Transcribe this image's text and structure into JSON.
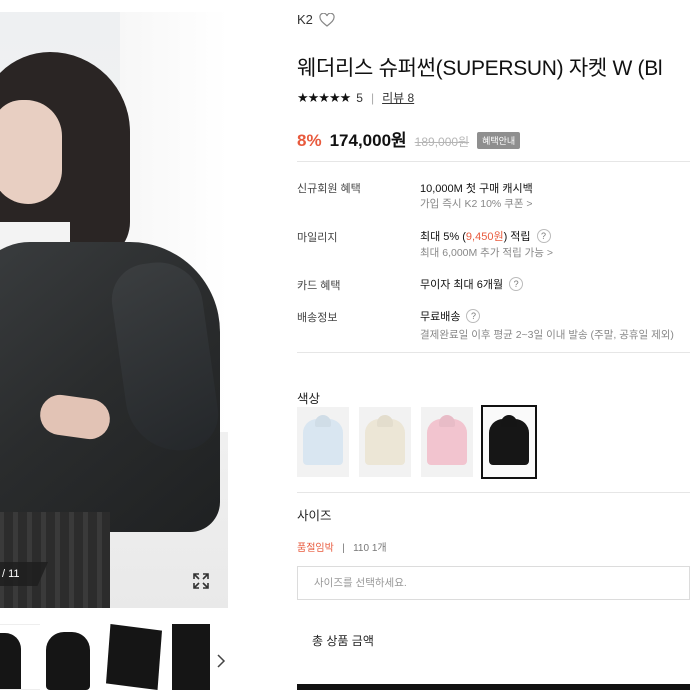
{
  "gallery": {
    "counter": "/ 11",
    "zoom_icon": "expand-icon",
    "next_icon": "chevron-right-icon"
  },
  "product": {
    "brand": "K2",
    "title": "웨더리스 슈퍼썬(SUPERSUN) 자켓 W (Bl",
    "rating_stars": "★★★★★",
    "rating": "5",
    "review_link": "리뷰 8",
    "discount": "8%",
    "price": "174,000원",
    "original_price": "189,000원",
    "benefit_badge": "혜택안내"
  },
  "benefits": {
    "new_member": {
      "label": "신규회원 혜택",
      "main": "10,000M 첫 구매 캐시백",
      "sub": "가입 즉시 K2 10% 쿠폰 >"
    },
    "mileage": {
      "label": "마일리지",
      "main_prefix": "최대 5% (",
      "main_highlight": "9,450원",
      "main_suffix": ") 적립",
      "sub": "최대 6,000M 추가 적립 가능 >"
    },
    "card": {
      "label": "카드 혜택",
      "main": "무이자 최대 6개월"
    },
    "shipping": {
      "label": "배송정보",
      "main": "무료배송",
      "sub": "결제완료일 이후 평균 2~3일 이내 발송 (주말, 공휴일 제외)"
    }
  },
  "color": {
    "label": "색상",
    "swatches": [
      {
        "name": "light-blue",
        "color": "#d9e6f1"
      },
      {
        "name": "beige",
        "color": "#ece6d6"
      },
      {
        "name": "pink",
        "color": "#f2c4cf"
      },
      {
        "name": "black",
        "color": "#161616"
      }
    ],
    "selected_index": 3
  },
  "size": {
    "label": "사이즈",
    "stock_tag": "품절임박",
    "stock_item": "110 1개",
    "select_placeholder": "사이즈를 선택하세요."
  },
  "total": {
    "label": "총 상품 금액"
  }
}
